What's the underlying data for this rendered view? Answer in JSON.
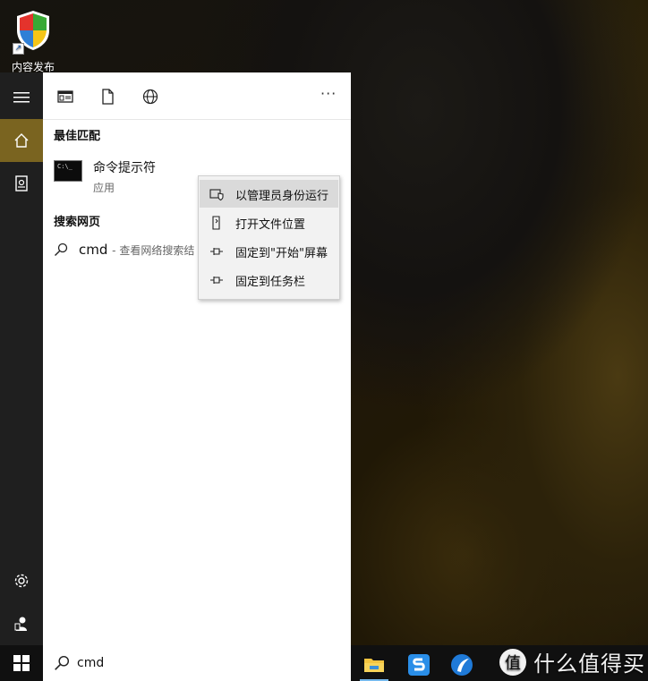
{
  "desktop": {
    "icon_label": "内容发布"
  },
  "toolbar": {
    "icons": [
      "apps-icon",
      "documents-icon",
      "web-icon"
    ],
    "more_label": "···"
  },
  "rail": {
    "items": [
      "hamburger-icon",
      "home-icon",
      "notebook-icon",
      "settings-icon",
      "user-icon"
    ]
  },
  "results": {
    "best_match_title": "最佳匹配",
    "best_match": {
      "name": "命令提示符",
      "type": "应用",
      "icon_text": "C:\\_"
    },
    "web_title": "搜索网页",
    "web_item": {
      "query": "cmd",
      "suffix": "- 查看网络搜索结"
    }
  },
  "context_menu": {
    "items": [
      {
        "label": "以管理员身份运行",
        "icon": "shield-run-icon",
        "highlighted": true
      },
      {
        "label": "打开文件位置",
        "icon": "file-location-icon",
        "highlighted": false
      },
      {
        "label": "固定到\"开始\"屏幕",
        "icon": "pin-icon",
        "highlighted": false
      },
      {
        "label": "固定到任务栏",
        "icon": "pin-icon",
        "highlighted": false
      }
    ]
  },
  "taskbar": {
    "search_value": "cmd",
    "apps": [
      "file-explorer-icon",
      "sogou-icon",
      "browser-icon"
    ],
    "watermark_text": "什么值得买"
  },
  "colors": {
    "accent": "#7a6420",
    "rail_bg": "#1f1f1f",
    "taskbar_bg": "#101010"
  }
}
